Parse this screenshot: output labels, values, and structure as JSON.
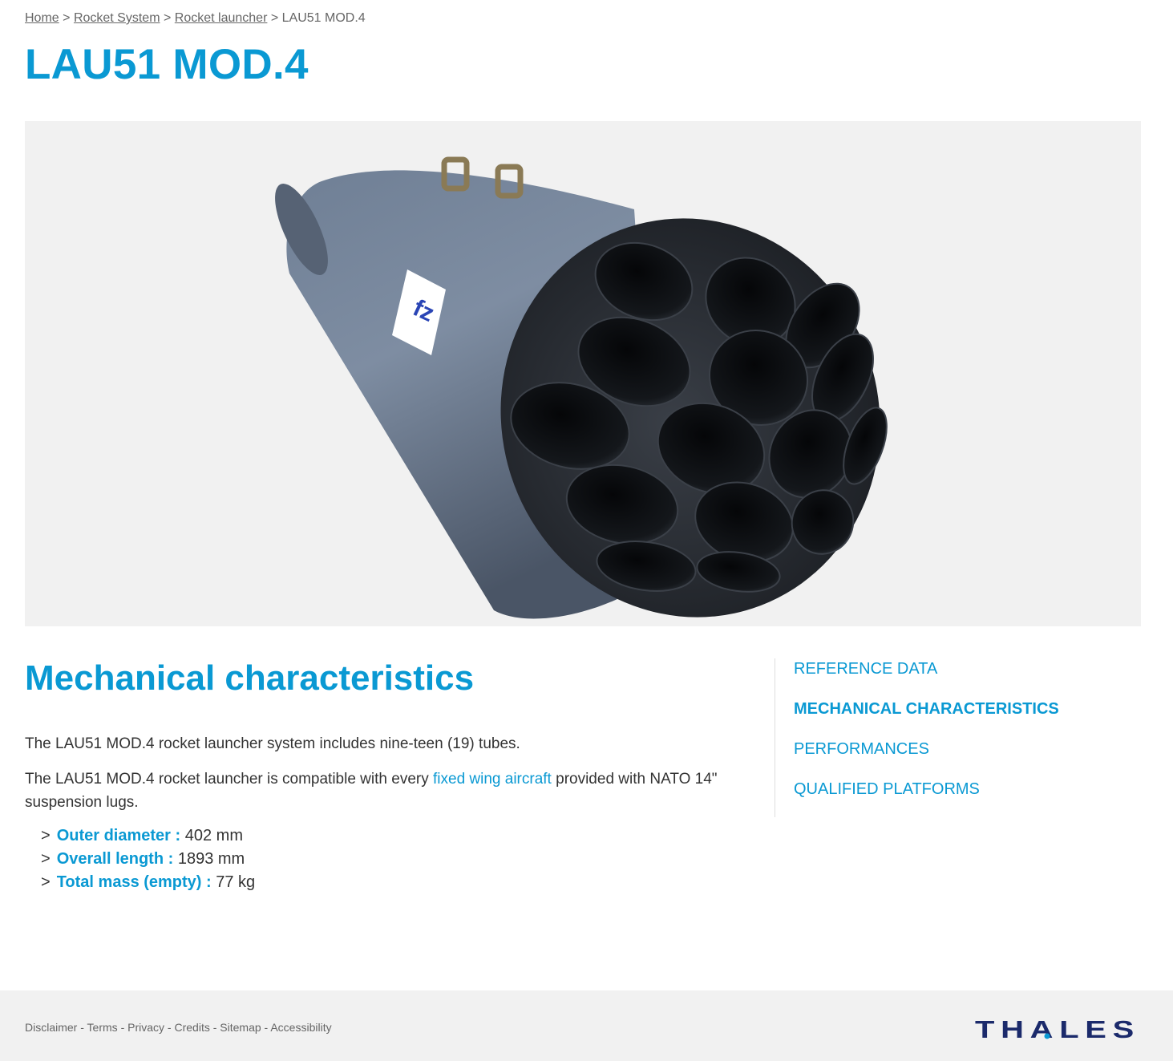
{
  "breadcrumb": {
    "home": "Home",
    "rocket_system": "Rocket System",
    "rocket_launcher": "Rocket launcher",
    "current": "LAU51 MOD.4",
    "separator": ">"
  },
  "page_title": "LAU51 MOD.4",
  "main": {
    "section_title": "Mechanical characteristics",
    "paragraph1": "The LAU51 MOD.4 rocket launcher system includes nine-teen (19) tubes.",
    "paragraph2_before": "The LAU51 MOD.4 rocket launcher is compatible with every ",
    "paragraph2_link": "fixed wing aircraft",
    "paragraph2_after": " provided with NATO 14\" suspension lugs.",
    "specs": [
      {
        "label": "Outer diameter :",
        "value": "402 mm"
      },
      {
        "label": "Overall length  :",
        "value": "1893 mm"
      },
      {
        "label": "Total mass (empty) :",
        "value": "77 kg"
      }
    ],
    "chevron": ">"
  },
  "sidenav": {
    "items": [
      {
        "label": "REFERENCE DATA",
        "active": false
      },
      {
        "label": "MECHANICAL CHARACTERISTICS",
        "active": true
      },
      {
        "label": "PERFORMANCES",
        "active": false
      },
      {
        "label": "QUALIFIED PLATFORMS",
        "active": false
      }
    ]
  },
  "footer": {
    "links": [
      "Disclaimer",
      "Terms",
      "Privacy",
      "Credits",
      "Sitemap",
      "Accessibility"
    ],
    "separator": "-",
    "logo_text": "THALES"
  },
  "colors": {
    "accent": "#0a99d3",
    "text": "#333333",
    "muted": "#666666",
    "logo": "#1b2a6b",
    "panel": "#f1f1f1"
  },
  "icons": {
    "chevron": "chevron-right-icon",
    "logo": "thales-logo"
  }
}
